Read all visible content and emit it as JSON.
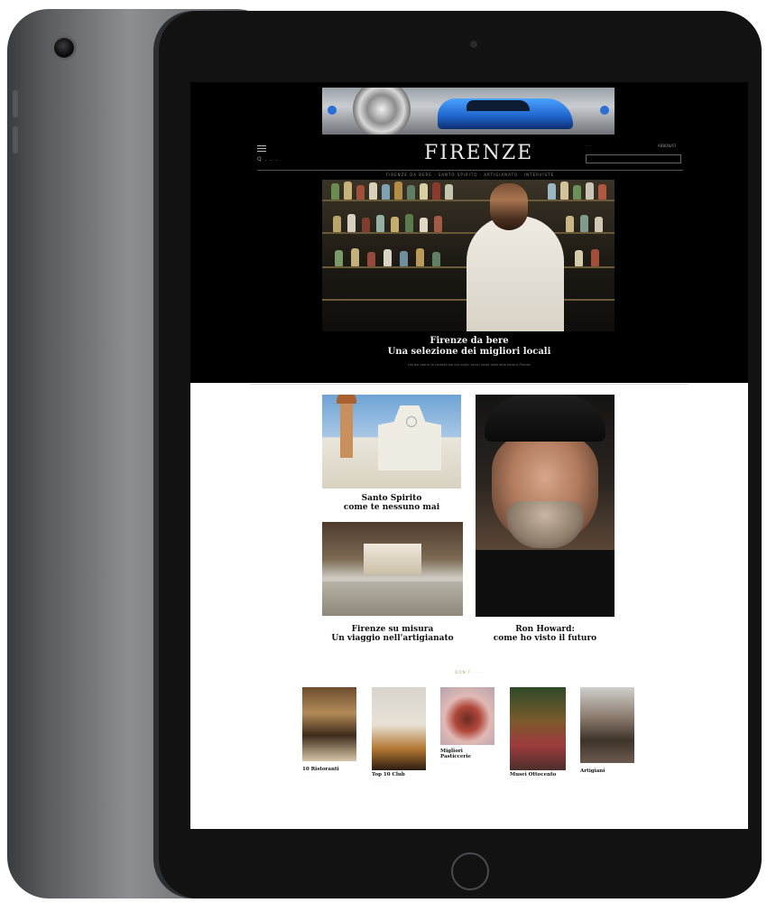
{
  "site": {
    "logo": "FIRENZE",
    "search_hint": "Q . . .",
    "nav_text": "FIRENZE DA BERE · SANTO SPIRITO · ARTIGIANATO · INTERVISTE",
    "topright_left": "· · ·",
    "topright_right": "ABBONATI"
  },
  "hero": {
    "title_line1": "Firenze da bere",
    "title_line2": "Una selezione dei migliori locali",
    "description": "Dai bar storici ai cocktail bar più nuovi, ecco i locali dove bere bene a Firenze"
  },
  "cards": [
    {
      "kicker": "· · ·",
      "title_line1": "Santo Spirito",
      "title_line2": "come te nessuno mai"
    },
    {
      "kicker": "· · ·",
      "title_line1": "Firenze su misura",
      "title_line2": "Un viaggio nell'artigianato"
    },
    {
      "kicker": "· · ·",
      "title_line1": "Ron Howard:",
      "title_line2": "come ho visto il futuro"
    }
  ],
  "section_label": "DON'T · · ·",
  "minis": [
    {
      "title_line1": "10 Ristoranti",
      "title_line2": "",
      "desc": "· · · · · · · · · · · · ·"
    },
    {
      "title_line1": "Top 10 Club",
      "title_line2": "",
      "desc": "· · · · · · · · · · · · ·"
    },
    {
      "title_line1": "Migliori",
      "title_line2": "Pasticcerie",
      "desc": "· · · · · · · · · · · · ·"
    },
    {
      "title_line1": "Musei Ottocento",
      "title_line2": "",
      "desc": "· · · · · · · · · · · · ·"
    },
    {
      "title_line1": "Artigiani",
      "title_line2": "",
      "desc": "· · · · · · · · · · · · ·"
    }
  ]
}
